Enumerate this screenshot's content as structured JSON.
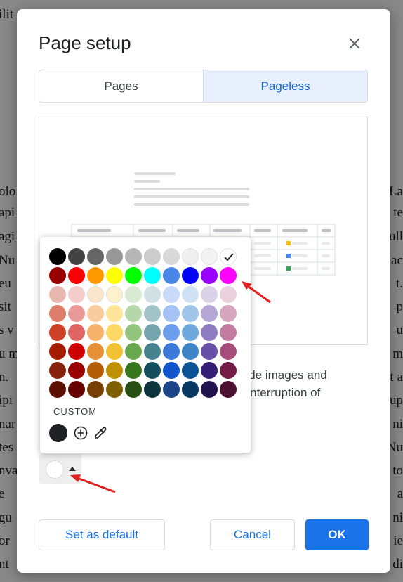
{
  "background_doc": {
    "lines": [
      {
        "left": "ilit",
        "right": ""
      },
      {
        "left": "olo",
        "right": "La"
      },
      {
        "left": "api",
        "right": "te"
      },
      {
        "left": "agi",
        "right": "ull"
      },
      {
        "left": "Nu",
        "right": "ac"
      },
      {
        "left": "eu",
        "right": "t."
      },
      {
        "left": "sit",
        "right": "p"
      },
      {
        "left": "s v",
        "right": "u"
      },
      {
        "left": "u m",
        "right": "m"
      },
      {
        "left": "n.",
        "right": "t a"
      },
      {
        "left": "ipi",
        "right": "up"
      },
      {
        "left": "nar",
        "right": "ni"
      },
      {
        "left": "tes",
        "right": "Nu"
      },
      {
        "left": "nva",
        "right": "to"
      },
      {
        "left": "e",
        "right": "a"
      },
      {
        "left": "gu",
        "right": "ni"
      },
      {
        "left": "or",
        "right": "ie"
      },
      {
        "left": "nt",
        "right": "di"
      }
    ]
  },
  "dialog": {
    "title": "Page setup",
    "tabs": [
      {
        "label": "Pages",
        "active": false
      },
      {
        "label": "Pageless",
        "active": true
      }
    ],
    "description_lines": [
      "d wide images and",
      "the interruption of"
    ],
    "buttons": {
      "set_default": "Set as default",
      "cancel": "Cancel",
      "ok": "OK"
    }
  },
  "palette": {
    "custom_label": "CUSTOM",
    "selected_color": "#ffffff",
    "rows": [
      [
        "#000000",
        "#434343",
        "#666666",
        "#999999",
        "#b7b7b7",
        "#cccccc",
        "#d9d9d9",
        "#efefef",
        "#f3f3f3",
        "#ffffff"
      ],
      [
        "#980000",
        "#ff0000",
        "#ff9900",
        "#ffff00",
        "#00ff00",
        "#00ffff",
        "#4a86e8",
        "#0000ff",
        "#9900ff",
        "#ff00ff"
      ],
      [
        "#e6b8af",
        "#f4cccc",
        "#fce5cd",
        "#fff2cc",
        "#d9ead3",
        "#d0e0e3",
        "#c9daf8",
        "#cfe2f3",
        "#d9d2e9",
        "#ead1dc"
      ],
      [
        "#dd7e6b",
        "#ea9999",
        "#f9cb9c",
        "#ffe599",
        "#b6d7a8",
        "#a2c4c9",
        "#a4c2f4",
        "#9fc5e8",
        "#b4a7d6",
        "#d5a6bd"
      ],
      [
        "#cc4125",
        "#e06666",
        "#f6b26b",
        "#ffd966",
        "#93c47d",
        "#76a5af",
        "#6d9eeb",
        "#6fa8dc",
        "#8e7cc3",
        "#c27ba0"
      ],
      [
        "#a61c00",
        "#cc0000",
        "#e69138",
        "#f1c232",
        "#6aa84f",
        "#45818e",
        "#3c78d8",
        "#3d85c6",
        "#674ea7",
        "#a64d79"
      ],
      [
        "#85200c",
        "#990000",
        "#b45f06",
        "#bf9000",
        "#38761d",
        "#134f5c",
        "#1155cc",
        "#0b5394",
        "#351c75",
        "#741b47"
      ],
      [
        "#5b0f00",
        "#660000",
        "#783f04",
        "#7f6000",
        "#274e13",
        "#0c343d",
        "#1c4587",
        "#073763",
        "#20124d",
        "#4c1130"
      ]
    ],
    "custom_swatch_color": "#202124"
  },
  "colors": {
    "accent": "#1a73e8",
    "annotation_arrow": "#e02020"
  }
}
